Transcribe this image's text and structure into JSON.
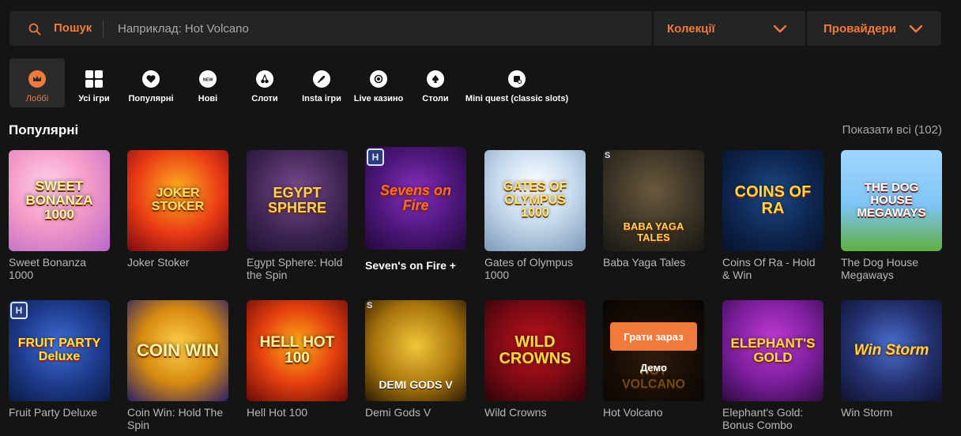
{
  "search": {
    "label": "Пошук",
    "placeholder": "Наприклад: Hot Volcano"
  },
  "filters": {
    "collections_label": "Колекції",
    "providers_label": "Провайдери"
  },
  "categories": [
    {
      "label": "Лоббі",
      "icon": "crown-icon",
      "active": true
    },
    {
      "label": "Усі ігри",
      "icon": "grid-icon"
    },
    {
      "label": "Популярні",
      "icon": "heart-icon"
    },
    {
      "label": "Нові",
      "icon": "new-icon"
    },
    {
      "label": "Слоти",
      "icon": "cherry-icon"
    },
    {
      "label": "Insta ігри",
      "icon": "rocket-icon"
    },
    {
      "label": "Live казино",
      "icon": "live-icon"
    },
    {
      "label": "Столи",
      "icon": "spade-icon"
    },
    {
      "label": "Mini quest (classic slots)",
      "icon": "quest-icon"
    }
  ],
  "section": {
    "title": "Популярні",
    "show_all": "Показати всі (102)"
  },
  "games": [
    {
      "title": "Sweet Bonanza 1000",
      "art": "SWEET BONANZA 1000"
    },
    {
      "title": "Joker Stoker",
      "art": "JOKER STOKER"
    },
    {
      "title": "Egypt Sphere: Hold the Spin",
      "art": "EGYPT SPHERE"
    },
    {
      "title": "Seven's on Fire +",
      "art": "Sevens on Fire"
    },
    {
      "title": "Gates of Olympus 1000",
      "art": "GATES OF OLYMPUS 1000"
    },
    {
      "title": "Baba Yaga Tales",
      "art": "BABA YAGA TALES"
    },
    {
      "title": "Coins Of Ra - Hold & Win",
      "art": "COINS OF RA"
    },
    {
      "title": "The Dog House Megaways",
      "art": "THE DOG HOUSE MEGAWAYS"
    },
    {
      "title": "Fruit Party Deluxe",
      "art": "FRUIT PARTY Deluxe"
    },
    {
      "title": "Coin Win: Hold The Spin",
      "art": "COIN WIN"
    },
    {
      "title": "Hell Hot 100",
      "art": "HELL HOT 100"
    },
    {
      "title": "Demi Gods V",
      "art": "DEMI GODS V"
    },
    {
      "title": "Wild Crowns",
      "art": "WILD CROWNS"
    },
    {
      "title": "Hot Volcano",
      "art": "HOT VOLCANO"
    },
    {
      "title": "Elephant's Gold: Bonus Combo",
      "art": "ELEPHANT'S GOLD"
    },
    {
      "title": "Win Storm",
      "art": "Win Storm"
    }
  ],
  "hover": {
    "play_label": "Грати зараз",
    "demo_label": "Демо"
  },
  "colors": {
    "accent": "#f07a3c",
    "background": "#141414",
    "bar": "#242424"
  }
}
